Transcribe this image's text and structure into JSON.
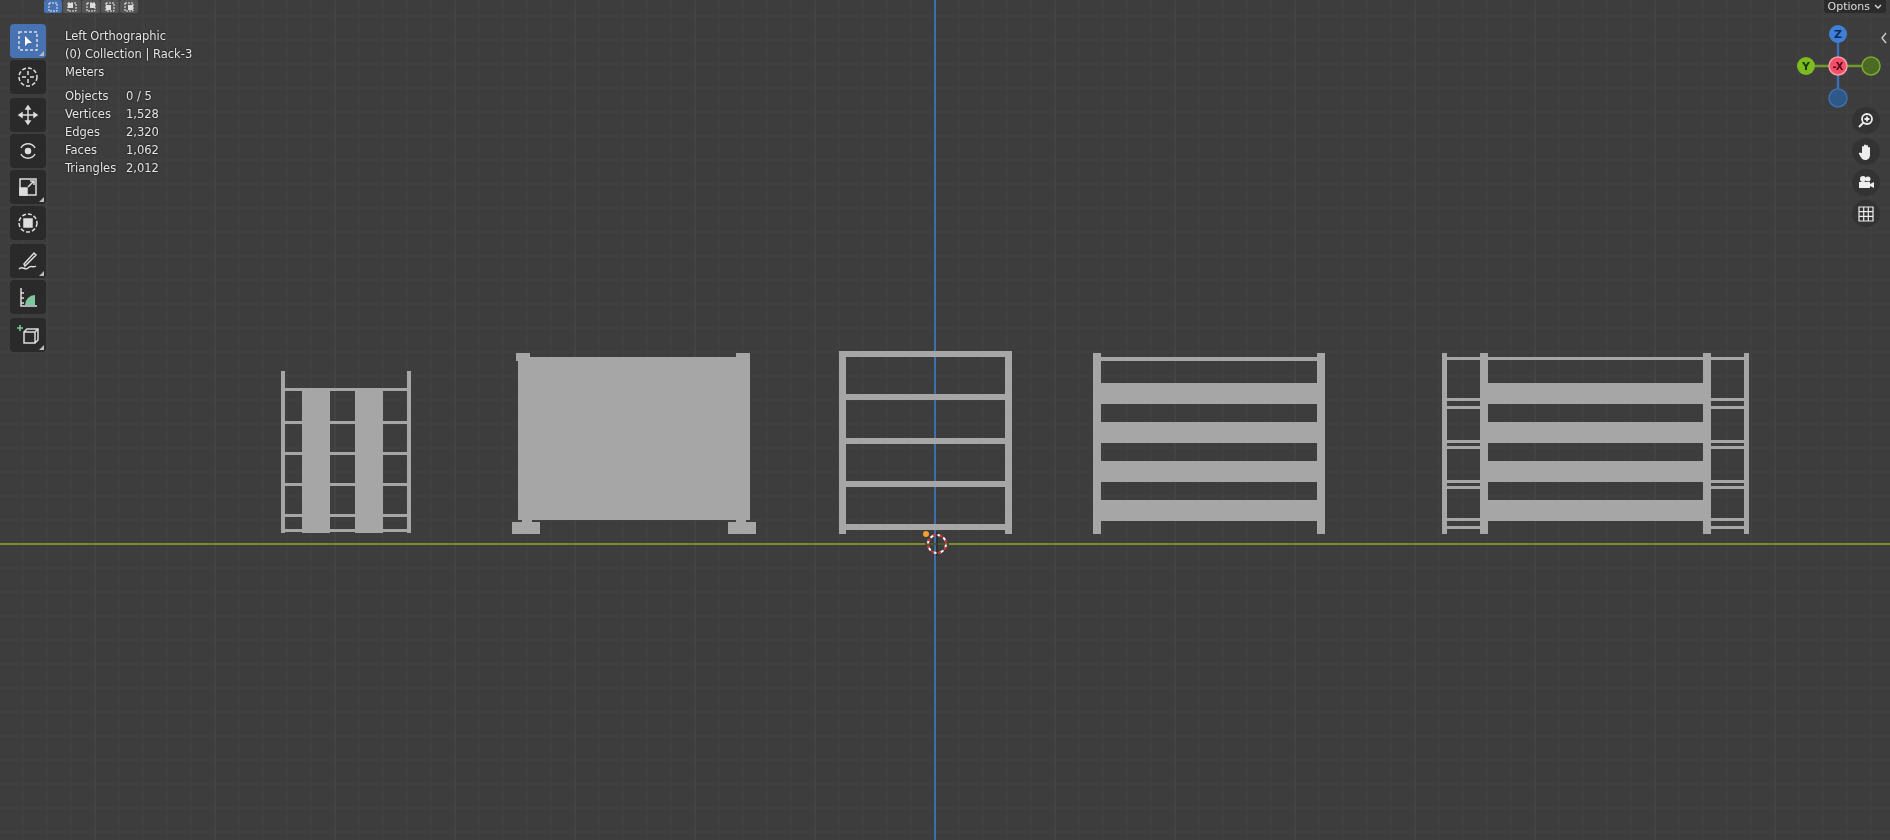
{
  "header": {
    "select_modes": [
      {
        "selected": true
      },
      {
        "selected": false
      },
      {
        "selected": false
      },
      {
        "selected": false
      },
      {
        "selected": false
      }
    ],
    "options": {
      "label": "Options"
    }
  },
  "overlay": {
    "view": "Left Orthographic",
    "collection": "(0) Collection | Rack-3",
    "units": "Meters",
    "stats": [
      {
        "label": "Objects",
        "value": "0 / 5"
      },
      {
        "label": "Vertices",
        "value": "1,528"
      },
      {
        "label": "Edges",
        "value": "2,320"
      },
      {
        "label": "Faces",
        "value": "1,062"
      },
      {
        "label": "Triangles",
        "value": "2,012"
      }
    ]
  },
  "toolbar": [
    {
      "kind": "select",
      "selected": true,
      "submenu": true
    },
    {
      "kind": "cursor",
      "selected": false,
      "submenu": false
    },
    {
      "kind": "move",
      "selected": false,
      "submenu": false
    },
    {
      "kind": "rotate",
      "selected": false,
      "submenu": false
    },
    {
      "kind": "scale",
      "selected": false,
      "submenu": true
    },
    {
      "kind": "transform",
      "selected": false,
      "submenu": false
    },
    {
      "kind": "annotate",
      "selected": false,
      "submenu": true
    },
    {
      "kind": "measure",
      "selected": false,
      "submenu": false
    },
    {
      "kind": "add-cube",
      "selected": false,
      "submenu": true
    }
  ],
  "gizmo": {
    "z": "Z",
    "y": "Y",
    "x": "-X"
  }
}
